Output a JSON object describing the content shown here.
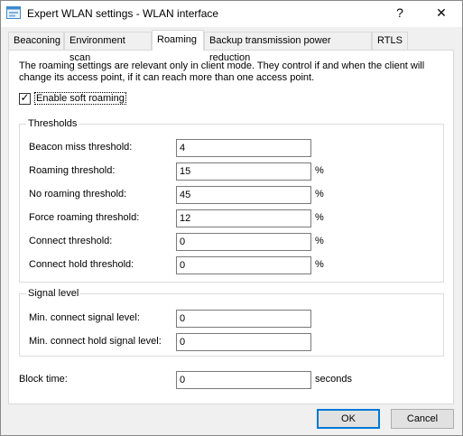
{
  "window": {
    "title": "Expert WLAN settings - WLAN interface",
    "help_glyph": "?",
    "close_glyph": "✕"
  },
  "tabs": [
    {
      "label": "Beaconing"
    },
    {
      "label": "Environment scan"
    },
    {
      "label": "Roaming"
    },
    {
      "label": "Backup transmission power reduction"
    },
    {
      "label": "RTLS"
    }
  ],
  "active_tab": "Roaming",
  "description": "The roaming settings are relevant only in client mode. They control if and when the client will change its access point, if it can reach more than one access point.",
  "soft_roaming": {
    "label": "Enable soft roaming",
    "checked": true,
    "check_glyph": "✓"
  },
  "thresholds": {
    "title": "Thresholds",
    "rows": [
      {
        "label": "Beacon miss threshold:",
        "value": "4",
        "unit": ""
      },
      {
        "label": "Roaming threshold:",
        "value": "15",
        "unit": "%"
      },
      {
        "label": "No roaming threshold:",
        "value": "45",
        "unit": "%"
      },
      {
        "label": "Force roaming threshold:",
        "value": "12",
        "unit": "%"
      },
      {
        "label": "Connect threshold:",
        "value": "0",
        "unit": "%"
      },
      {
        "label": "Connect hold threshold:",
        "value": "0",
        "unit": "%"
      }
    ]
  },
  "signal_level": {
    "title": "Signal level",
    "rows": [
      {
        "label": "Min. connect signal level:",
        "value": "0"
      },
      {
        "label": "Min. connect hold signal level:",
        "value": "0"
      }
    ]
  },
  "block_time": {
    "label": "Block time:",
    "value": "0",
    "unit": "seconds"
  },
  "buttons": {
    "ok": "OK",
    "cancel": "Cancel"
  },
  "colors": {
    "accent": "#0078d7",
    "icon": "#3c8bd0"
  }
}
